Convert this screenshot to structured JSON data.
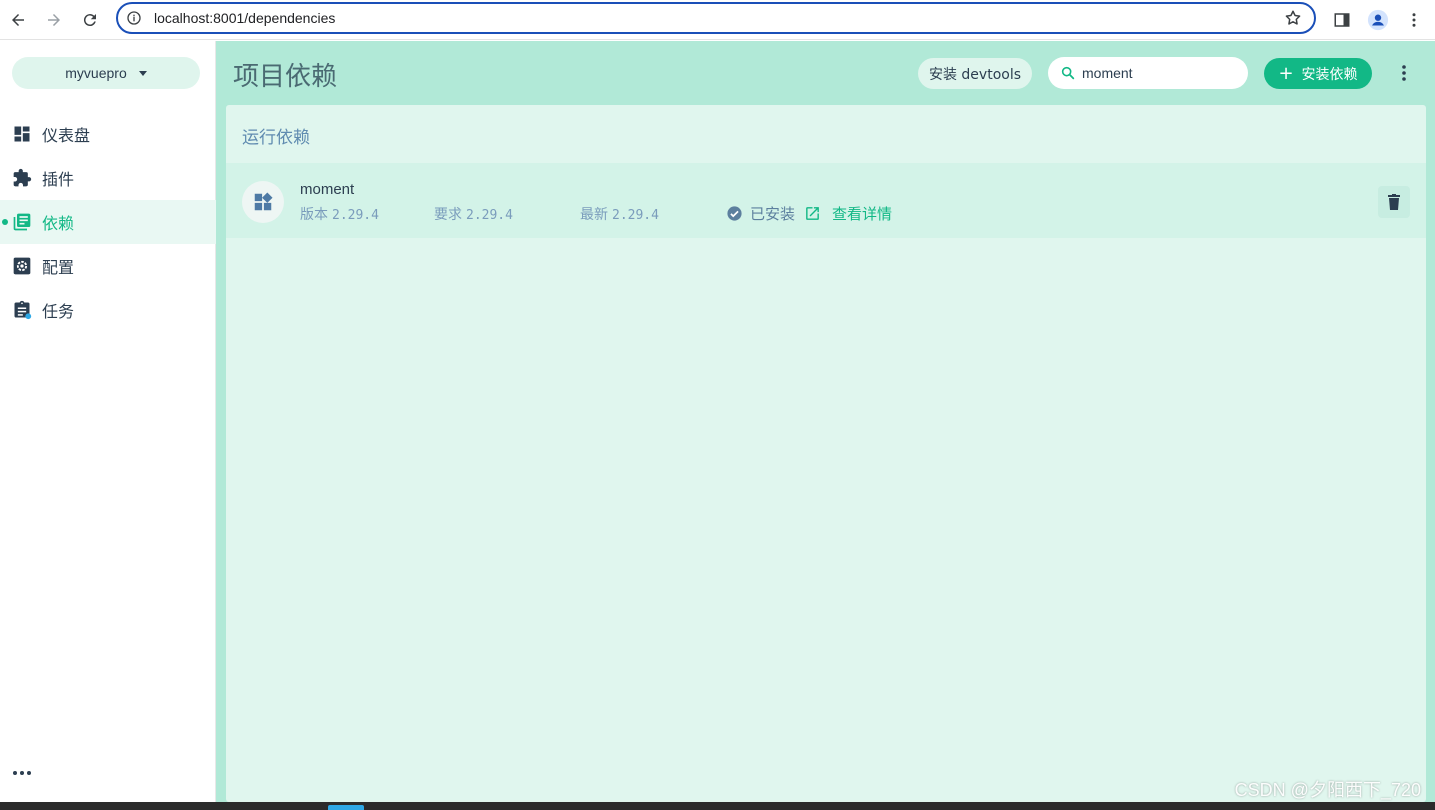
{
  "browser": {
    "url": "localhost:8001/dependencies"
  },
  "sidebar": {
    "project_name": "myvuepro",
    "items": [
      {
        "label": "仪表盘",
        "icon": "dashboard-icon",
        "active": false
      },
      {
        "label": "插件",
        "icon": "puzzle-icon",
        "active": false
      },
      {
        "label": "依赖",
        "icon": "library-books-icon",
        "active": true
      },
      {
        "label": "配置",
        "icon": "settings-applications-icon",
        "active": false
      },
      {
        "label": "任务",
        "icon": "assignment-icon",
        "active": false
      }
    ]
  },
  "header": {
    "title": "项目依赖",
    "devtools_label": "安装 devtools",
    "search_value": "moment",
    "install_label": "安装依赖"
  },
  "section": {
    "title": "运行依赖"
  },
  "dependency": {
    "name": "moment",
    "version_label": "版本",
    "version": "2.29.4",
    "wanted_label": "要求",
    "wanted": "2.29.4",
    "latest_label": "最新",
    "latest": "2.29.4",
    "installed_label": "已安装",
    "details_label": "查看详情"
  },
  "watermark": "CSDN @夕阳西下_720",
  "colors": {
    "accent": "#12b886",
    "main_bg": "#b1e9d7",
    "panel_bg": "#e0f6ee",
    "text_muted": "#7a9cbc"
  }
}
